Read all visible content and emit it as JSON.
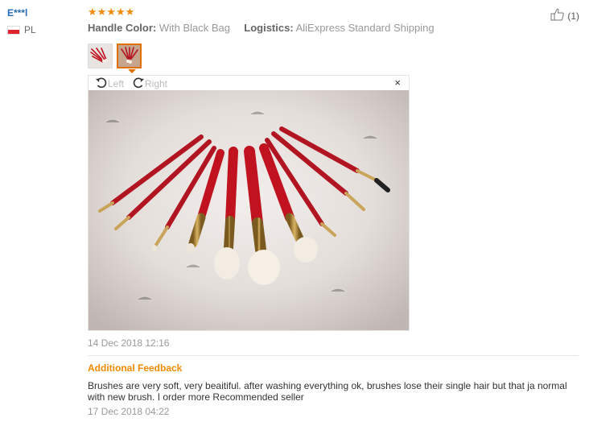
{
  "reviewer": {
    "name": "E***l",
    "country_code": "PL",
    "flag_colors": [
      "#ffffff",
      "#e0242f"
    ]
  },
  "review": {
    "rating": 5,
    "rating_max": 5,
    "star_color": "#f28a10",
    "attributes": [
      {
        "label": "Handle Color:",
        "value": "With Black Bag"
      },
      {
        "label": "Logistics:",
        "value": "AliExpress Standard Shipping"
      }
    ],
    "helpful_count": "(1)",
    "date": "14 Dec 2018 12:16"
  },
  "viewer": {
    "rotate_left_label": "Left",
    "rotate_right_label": "Right",
    "close_label": "×",
    "selected_thumb_border": "#e07000"
  },
  "additional_feedback": {
    "title": "Additional Feedback",
    "text": "Brushes are very soft, very beaitiful. after washing everything ok, brushes lose their single hair but that ja normal with new brush. I order more Recommended seller",
    "date": "17 Dec 2018 04:22",
    "title_color": "#f08a00"
  }
}
